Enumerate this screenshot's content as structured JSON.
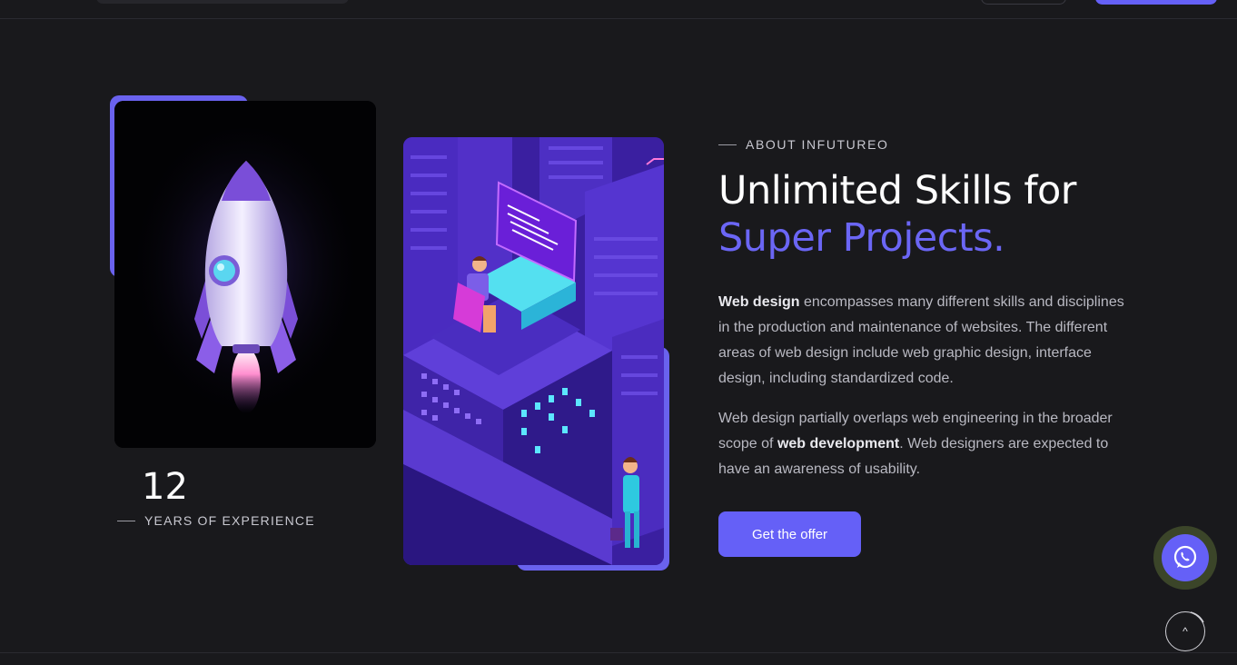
{
  "experience": {
    "number": "12",
    "label": "YEARS OF EXPERIENCE"
  },
  "about": {
    "eyebrow": "ABOUT  INFUTUREO",
    "title_line1": "Unlimited Skills for",
    "title_line2": "Super Projects.",
    "p1_bold": "Web design",
    "p1_rest": " encompasses many different skills and disciplines in the production and maintenance of websites. The different areas of web design include web graphic design, interface design, including standardized code.",
    "p2_start": "Web design partially overlaps web engineering in the broader scope of ",
    "p2_bold": "web development",
    "p2_end": ". Web designers are expected to have an awareness of usability.",
    "cta_label": "Get the offer"
  },
  "floating": {
    "scroll_top_glyph": "^"
  },
  "icons": [
    "rocket-illustration",
    "city-illustration",
    "whatsapp-icon",
    "scroll-top-icon"
  ],
  "colors": {
    "accent": "#6560f7",
    "background": "#19191c",
    "text": "#e9e9ee"
  }
}
